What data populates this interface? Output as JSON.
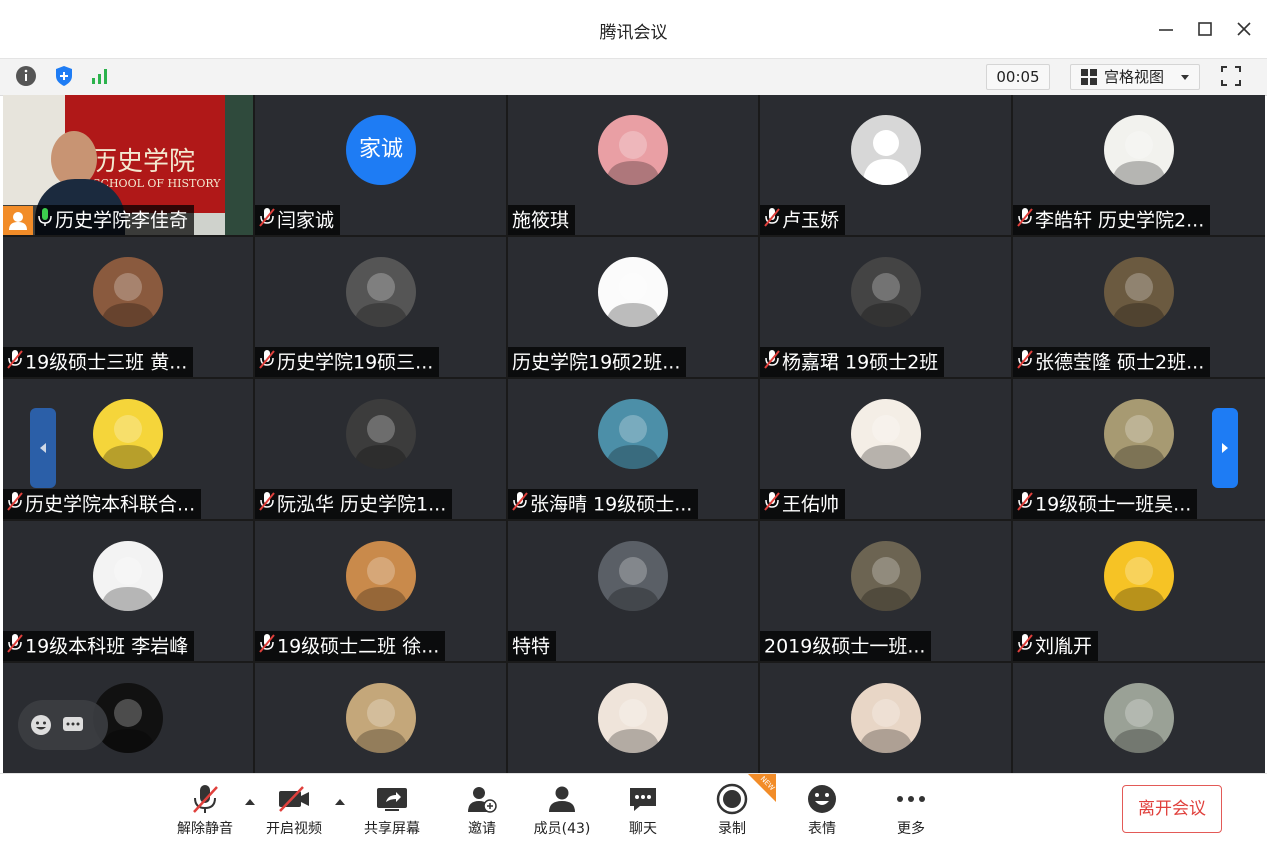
{
  "window": {
    "title": "腾讯会议"
  },
  "toolbar": {
    "timer": "00:05",
    "view_label": "宫格视图"
  },
  "participants": [
    {
      "name": "历史学院李佳奇",
      "muted": false,
      "host": true,
      "avatar": "video",
      "color": "#b01818"
    },
    {
      "name": "闫家诚",
      "muted": true,
      "avatar": "text",
      "avatar_text": "家诚",
      "color": "#1e7cf4"
    },
    {
      "name": "施筱琪",
      "muted": false,
      "avatar": "image",
      "color": "#e99fa4"
    },
    {
      "name": "卢玉娇",
      "muted": true,
      "avatar": "default",
      "color": "#d7d7d7"
    },
    {
      "name": "李皓轩 历史学院2...",
      "muted": true,
      "avatar": "image",
      "color": "#f2f2ee"
    },
    {
      "name": "19级硕士三班 黄...",
      "muted": true,
      "avatar": "image",
      "color": "#8a5a3e"
    },
    {
      "name": "历史学院19硕三...",
      "muted": true,
      "avatar": "image",
      "color": "#555"
    },
    {
      "name": "历史学院19硕2班...",
      "muted": false,
      "avatar": "image",
      "color": "#fbfbfb"
    },
    {
      "name": "杨嘉珺 19硕士2班",
      "muted": true,
      "avatar": "image",
      "color": "#444"
    },
    {
      "name": "张德莹隆 硕士2班...",
      "muted": true,
      "avatar": "image",
      "color": "#6b5a40"
    },
    {
      "name": "历史学院本科联合...",
      "muted": true,
      "avatar": "image",
      "color": "#f5d53a"
    },
    {
      "name": "阮泓华 历史学院1...",
      "muted": true,
      "avatar": "image",
      "color": "#3c3c3c"
    },
    {
      "name": "张海晴 19级硕士...",
      "muted": true,
      "avatar": "image",
      "color": "#4c8fa8"
    },
    {
      "name": "王佑帅",
      "muted": true,
      "avatar": "image",
      "color": "#f4eee6"
    },
    {
      "name": "19级硕士一班吴...",
      "muted": true,
      "avatar": "image",
      "color": "#a79a72"
    },
    {
      "name": "19级本科班 李岩峰",
      "muted": true,
      "avatar": "image",
      "color": "#f3f3f3"
    },
    {
      "name": "19级硕士二班 徐...",
      "muted": true,
      "avatar": "image",
      "color": "#c98a4b"
    },
    {
      "name": "特特",
      "muted": false,
      "avatar": "image",
      "color": "#5a5f66"
    },
    {
      "name": "2019级硕士一班...",
      "muted": false,
      "avatar": "image",
      "color": "#6c6452"
    },
    {
      "name": "刘胤开",
      "muted": true,
      "avatar": "image",
      "color": "#f6c325"
    },
    {
      "name": "",
      "muted": false,
      "avatar": "image",
      "color": "#111"
    },
    {
      "name": "",
      "muted": false,
      "avatar": "image",
      "color": "#c4a77a"
    },
    {
      "name": "",
      "muted": false,
      "avatar": "image",
      "color": "#efe4da"
    },
    {
      "name": "",
      "muted": false,
      "avatar": "image",
      "color": "#e8d6c6"
    },
    {
      "name": "",
      "muted": false,
      "avatar": "image",
      "color": "#9aa196"
    }
  ],
  "bottom": {
    "mute": "解除静音",
    "video": "开启视频",
    "share": "共享屏幕",
    "invite": "邀请",
    "members": "成员(43)",
    "chat": "聊天",
    "record": "录制",
    "record_badge": "NEW",
    "emoji": "表情",
    "more": "更多",
    "leave": "离开会议"
  },
  "video_banner": "历史学院",
  "video_banner_sub": "SCHOOL OF HISTORY",
  "colors": {
    "accent": "#1e7cf4",
    "leave": "#e0403c",
    "tile": "#2a2c31"
  }
}
